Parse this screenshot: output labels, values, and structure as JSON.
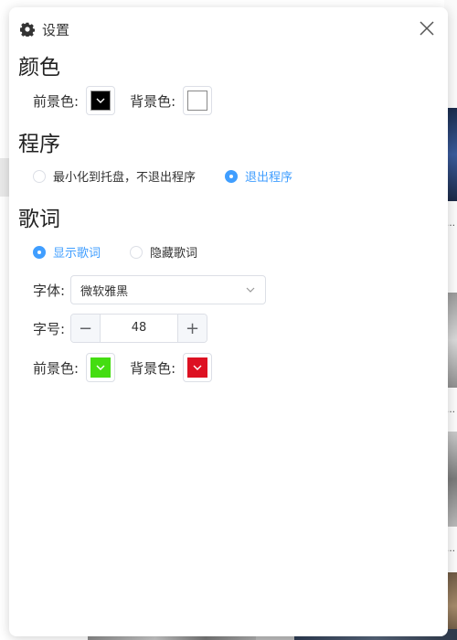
{
  "header": {
    "title": "设置"
  },
  "color_section": {
    "title": "颜色",
    "foreground_label": "前景色:",
    "background_label": "背景色:",
    "foreground_color": "#000000",
    "background_color": "#ffffff"
  },
  "program_section": {
    "title": "程序",
    "options": [
      {
        "label": "最小化到托盘，不退出程序",
        "selected": false
      },
      {
        "label": "退出程序",
        "selected": true
      }
    ]
  },
  "lyrics_section": {
    "title": "歌词",
    "options": [
      {
        "label": "显示歌词",
        "selected": true
      },
      {
        "label": "隐藏歌词",
        "selected": false
      }
    ],
    "font_label": "字体:",
    "font_value": "微软雅黑",
    "size_label": "字号:",
    "size_minus": "−",
    "size_value": "48",
    "size_plus": "+",
    "foreground_label": "前景色:",
    "background_label": "背景色:",
    "foreground_color": "#44dd11",
    "background_color": "#dd1122"
  },
  "colors": {
    "accent": "#409eff",
    "border": "#dcdfe6"
  },
  "icons": {
    "header": "gear-icon",
    "close": "close-icon",
    "select": "chevron-down-icon"
  }
}
